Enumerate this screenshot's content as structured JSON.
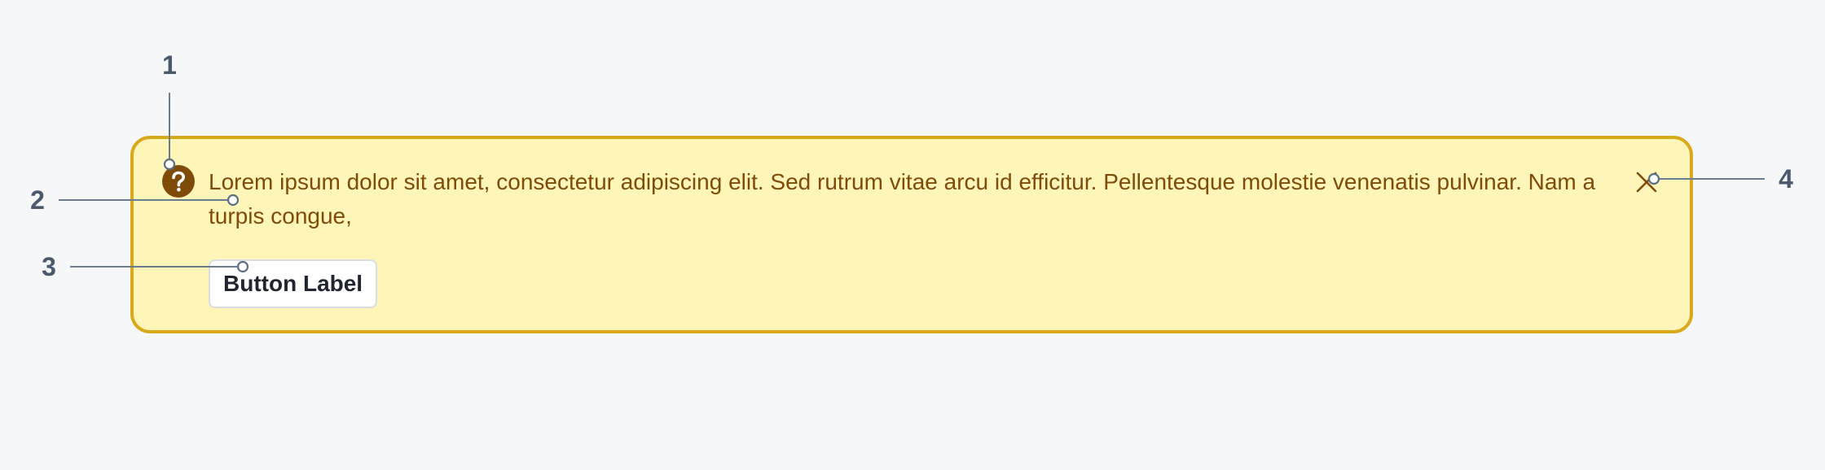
{
  "banner": {
    "message": "Lorem ipsum dolor sit amet, consectetur adipiscing elit. Sed rutrum vitae arcu id efficitur. Pellentesque molestie venenatis pulvinar. Nam a turpis congue,",
    "button_label": "Button Label",
    "icon": "question-circle-icon",
    "close_icon": "close-icon",
    "colors": {
      "background": "#fef5b8",
      "border": "#d9a91c",
      "text": "#7f4b09",
      "icon": "#7f4b09"
    }
  },
  "callouts": {
    "one": "1",
    "two": "2",
    "three": "3",
    "four": "4"
  }
}
